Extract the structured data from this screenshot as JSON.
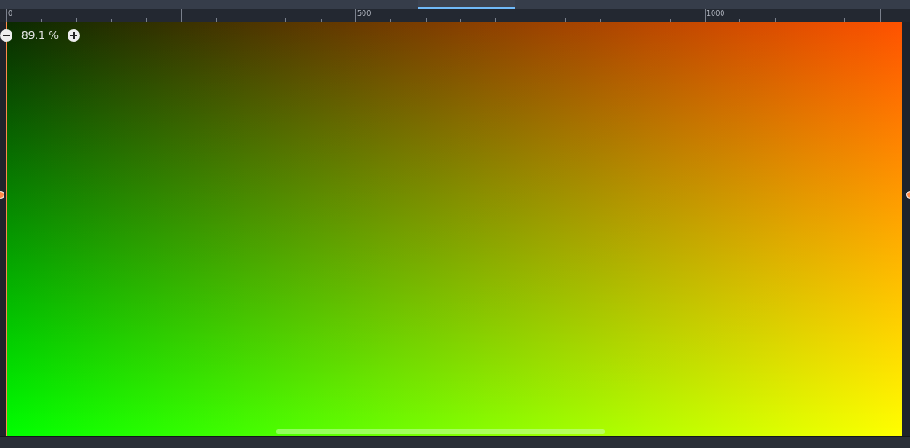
{
  "ruler": {
    "labels": [
      "0",
      "500",
      "1000"
    ]
  },
  "zoom": {
    "value": "89.1 %"
  }
}
